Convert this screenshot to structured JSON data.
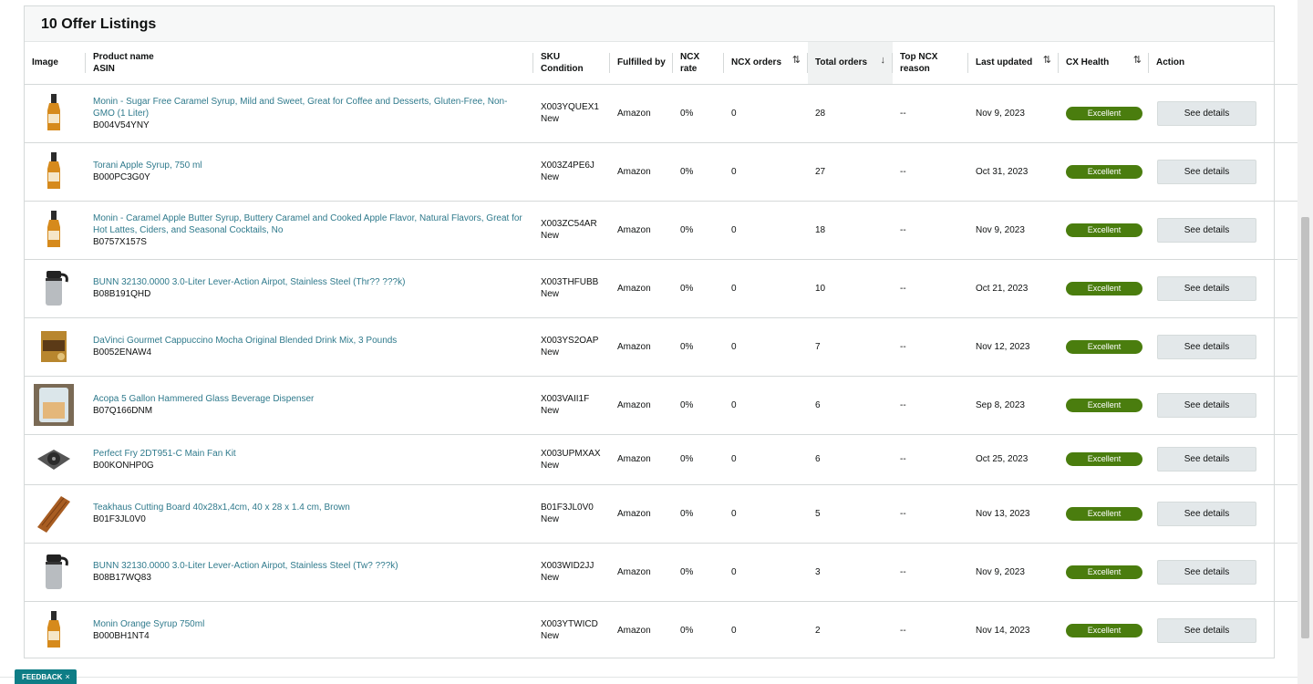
{
  "header": {
    "title": "10 Offer Listings"
  },
  "columns": {
    "image": "Image",
    "product_name": "Product name",
    "asin": "ASIN",
    "sku": "SKU",
    "condition": "Condition",
    "fulfilled_by": "Fulfilled by",
    "ncx_rate": "NCX rate",
    "ncx_orders": "NCX orders",
    "total_orders": "Total orders",
    "top_ncx_reason": "Top NCX reason",
    "last_updated": "Last updated",
    "cx_health": "CX Health",
    "action": "Action"
  },
  "icons": {
    "sort_both": "⇅",
    "sort_down": "↓"
  },
  "rows": [
    {
      "name": "Monin - Sugar Free Caramel Syrup, Mild and Sweet, Great for Coffee and Desserts, Gluten-Free, Non-GMO (1 Liter)",
      "asin": "B004V54YNY",
      "sku": "X003YQUEX1",
      "condition": "New",
      "fulfilled_by": "Amazon",
      "ncx_rate": "0%",
      "ncx_orders": "0",
      "total_orders": "28",
      "top_ncx_reason": "--",
      "last_updated": "Nov 9, 2023",
      "cx_health": "Excellent",
      "action": "See details",
      "image_icon": "syrup-bottle-icon"
    },
    {
      "name": "Torani Apple Syrup, 750 ml",
      "asin": "B000PC3G0Y",
      "sku": "X003Z4PE6J",
      "condition": "New",
      "fulfilled_by": "Amazon",
      "ncx_rate": "0%",
      "ncx_orders": "0",
      "total_orders": "27",
      "top_ncx_reason": "--",
      "last_updated": "Oct 31, 2023",
      "cx_health": "Excellent",
      "action": "See details",
      "image_icon": "syrup-bottle-icon"
    },
    {
      "name": "Monin - Caramel Apple Butter Syrup, Buttery Caramel and Cooked Apple Flavor, Natural Flavors, Great for Hot Lattes, Ciders, and Seasonal Cocktails, No",
      "asin": "B0757X157S",
      "sku": "X003ZC54AR",
      "condition": "New",
      "fulfilled_by": "Amazon",
      "ncx_rate": "0%",
      "ncx_orders": "0",
      "total_orders": "18",
      "top_ncx_reason": "--",
      "last_updated": "Nov 9, 2023",
      "cx_health": "Excellent",
      "action": "See details",
      "image_icon": "syrup-bottle-icon"
    },
    {
      "name": "BUNN 32130.0000 3.0-Liter Lever-Action Airpot, Stainless Steel (Thr?? ???k)",
      "asin": "B08B191QHD",
      "sku": "X003THFUBB",
      "condition": "New",
      "fulfilled_by": "Amazon",
      "ncx_rate": "0%",
      "ncx_orders": "0",
      "total_orders": "10",
      "top_ncx_reason": "--",
      "last_updated": "Oct 21, 2023",
      "cx_health": "Excellent",
      "action": "See details",
      "image_icon": "airpot-icon"
    },
    {
      "name": "DaVinci Gourmet Cappuccino Mocha Original Blended Drink Mix, 3 Pounds",
      "asin": "B0052ENAW4",
      "sku": "X003YS2OAP",
      "condition": "New",
      "fulfilled_by": "Amazon",
      "ncx_rate": "0%",
      "ncx_orders": "0",
      "total_orders": "7",
      "top_ncx_reason": "--",
      "last_updated": "Nov 12, 2023",
      "cx_health": "Excellent",
      "action": "See details",
      "image_icon": "drink-mix-bag-icon"
    },
    {
      "name": "Acopa 5 Gallon Hammered Glass Beverage Dispenser",
      "asin": "B07Q166DNM",
      "sku": "X003VAII1F",
      "condition": "New",
      "fulfilled_by": "Amazon",
      "ncx_rate": "0%",
      "ncx_orders": "0",
      "total_orders": "6",
      "top_ncx_reason": "--",
      "last_updated": "Sep 8, 2023",
      "cx_health": "Excellent",
      "action": "See details",
      "image_icon": "beverage-dispenser-icon"
    },
    {
      "name": "Perfect Fry 2DT951-C Main Fan Kit",
      "asin": "B00KONHP0G",
      "sku": "X003UPMXAX",
      "condition": "New",
      "fulfilled_by": "Amazon",
      "ncx_rate": "0%",
      "ncx_orders": "0",
      "total_orders": "6",
      "top_ncx_reason": "--",
      "last_updated": "Oct 25, 2023",
      "cx_health": "Excellent",
      "action": "See details",
      "image_icon": "fan-kit-icon"
    },
    {
      "name": "Teakhaus Cutting Board 40x28x1,4cm, 40 x 28 x 1.4 cm, Brown",
      "asin": "B01F3JL0V0",
      "sku": "B01F3JL0V0",
      "condition": "New",
      "fulfilled_by": "Amazon",
      "ncx_rate": "0%",
      "ncx_orders": "0",
      "total_orders": "5",
      "top_ncx_reason": "--",
      "last_updated": "Nov 13, 2023",
      "cx_health": "Excellent",
      "action": "See details",
      "image_icon": "cutting-board-icon"
    },
    {
      "name": "BUNN 32130.0000 3.0-Liter Lever-Action Airpot, Stainless Steel (Tw? ???k)",
      "asin": "B08B17WQ83",
      "sku": "X003WID2JJ",
      "condition": "New",
      "fulfilled_by": "Amazon",
      "ncx_rate": "0%",
      "ncx_orders": "0",
      "total_orders": "3",
      "top_ncx_reason": "--",
      "last_updated": "Nov 9, 2023",
      "cx_health": "Excellent",
      "action": "See details",
      "image_icon": "airpot-icon"
    },
    {
      "name": "Monin Orange Syrup 750ml",
      "asin": "B000BH1NT4",
      "sku": "X003YTWICD",
      "condition": "New",
      "fulfilled_by": "Amazon",
      "ncx_rate": "0%",
      "ncx_orders": "0",
      "total_orders": "2",
      "top_ncx_reason": "--",
      "last_updated": "Nov 14, 2023",
      "cx_health": "Excellent",
      "action": "See details",
      "image_icon": "syrup-bottle-icon"
    }
  ],
  "feedback": {
    "label": "FEEDBACK",
    "close": "×"
  },
  "colors": {
    "link": "#2f7a8c",
    "badge": "#4a7d0e",
    "feedback": "#0e7d86"
  }
}
